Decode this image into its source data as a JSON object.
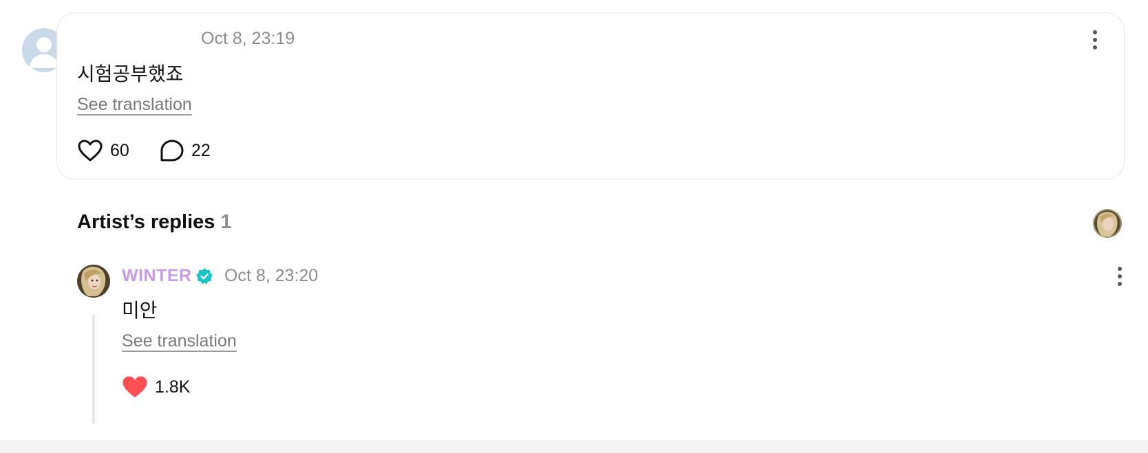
{
  "comment": {
    "time": "Oct 8, 23:19",
    "text": "시험공부했죠",
    "translate_label": "See translation",
    "likes": "60",
    "replies": "22"
  },
  "artist_replies": {
    "title": "Artist’s replies",
    "count": "1"
  },
  "reply": {
    "author": "WINTER",
    "time": "Oct 8, 23:20",
    "text": "미안",
    "translate_label": "See translation",
    "likes": "1.8K"
  },
  "colors": {
    "artist_name": "#c79be5",
    "verified_badge": "#19c5c9",
    "liked_heart": "#ff4f55",
    "avatar_placeholder": "#c9d9e8"
  },
  "icons": {
    "like": "heart-outline-icon",
    "liked": "heart-filled-icon",
    "comment": "speech-bubble-icon",
    "more": "more-vertical-icon",
    "verified": "verified-badge-icon"
  }
}
